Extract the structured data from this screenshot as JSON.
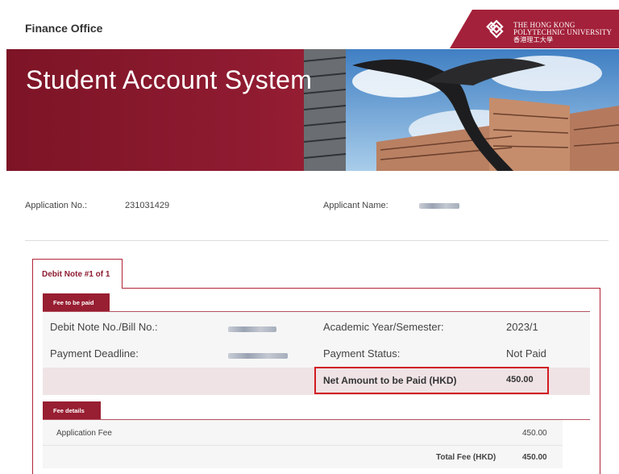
{
  "header": {
    "department": "Finance Office",
    "university_en_line1": "The Hong Kong",
    "university_en_line2": "Polytechnic University",
    "university_cn": "香港理工大學",
    "logo_icon": "polyu-logo-icon"
  },
  "banner": {
    "title": "Student Account System"
  },
  "applicant": {
    "app_no_label": "Application No.:",
    "app_no_value": "231031429",
    "name_label": "Applicant Name:"
  },
  "tab": {
    "label": "Debit Note #1 of 1"
  },
  "fee_to_be_paid": {
    "heading": "Fee to be paid",
    "debit_note_label": "Debit Note No./Bill No.:",
    "deadline_label": "Payment Deadline:",
    "academic_label": "Academic Year/Semester:",
    "academic_value": "2023/1",
    "status_label": "Payment Status:",
    "status_value": "Not Paid",
    "net_label": "Net Amount to be Paid (HKD)",
    "net_value": "450.00"
  },
  "fee_details": {
    "heading": "Fee details",
    "items": [
      {
        "label": "Application Fee",
        "amount": "450.00"
      }
    ],
    "total_label": "Total Fee (HKD)",
    "total_value": "450.00"
  },
  "colors": {
    "brand": "#981e32",
    "highlight": "#d11b22"
  }
}
